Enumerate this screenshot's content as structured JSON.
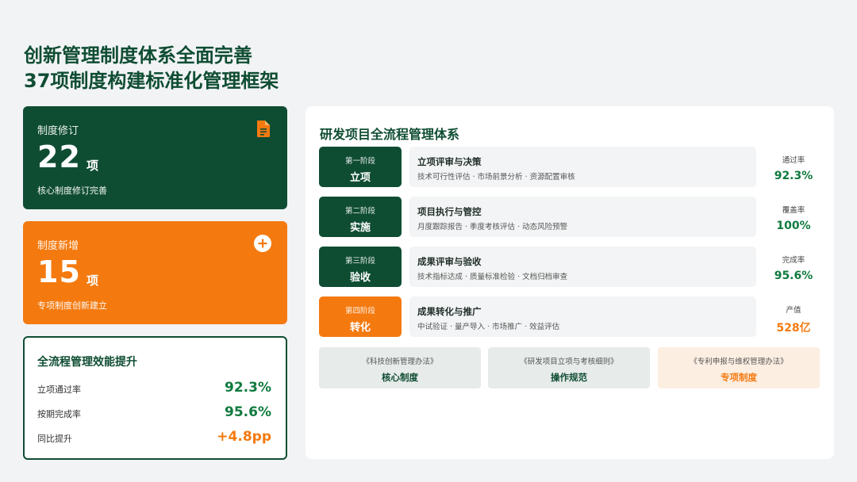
{
  "title": {
    "line1": "创新管理制度体系全面完善",
    "line2": "37项制度构建标准化管理框架"
  },
  "card_revise": {
    "label": "制度修订",
    "number": "22",
    "unit": "项",
    "sub": "核心制度修订完善",
    "icon": "document-icon",
    "color": "#0f4d33"
  },
  "card_new": {
    "label": "制度新增",
    "number": "15",
    "unit": "项",
    "sub": "专项制度创新建立",
    "icon": "plus-circle-icon",
    "color": "#f47a10"
  },
  "efficiency": {
    "title": "全流程管理效能提升",
    "rows": [
      {
        "label": "立项通过率",
        "value": "92.3%"
      },
      {
        "label": "按期完成率",
        "value": "95.6%"
      },
      {
        "label": "同比提升",
        "value": "+4.8pp"
      }
    ]
  },
  "panel": {
    "title": "研发项目全流程管理体系",
    "stages": [
      {
        "phase": "第一阶段",
        "name": "立项",
        "title": "立项评审与决策",
        "desc": "技术可行性评估 · 市场前景分析 · 资源配置审核",
        "metric_label": "通过率",
        "metric_value": "92.3%"
      },
      {
        "phase": "第二阶段",
        "name": "实施",
        "title": "项目执行与管控",
        "desc": "月度跟踪报告 · 季度考核评估 · 动态风险预警",
        "metric_label": "覆盖率",
        "metric_value": "100%"
      },
      {
        "phase": "第三阶段",
        "name": "验收",
        "title": "成果评审与验收",
        "desc": "技术指标达成 · 质量标准检验 · 文档归档审查",
        "metric_label": "完成率",
        "metric_value": "95.6%"
      },
      {
        "phase": "第四阶段",
        "name": "转化",
        "title": "成果转化与推广",
        "desc": "中试验证 · 量产导入 · 市场推广 · 效益评估",
        "metric_label": "产值",
        "metric_value": "528亿"
      }
    ],
    "regulations": [
      {
        "name": "《科技创新管理办法》",
        "type": "核心制度"
      },
      {
        "name": "《研发项目立项与考核细则》",
        "type": "操作规范"
      },
      {
        "name": "《专利申报与维权管理办法》",
        "type": "专项制度"
      }
    ]
  },
  "colors": {
    "primary_green": "#0f4d33",
    "accent_orange": "#f47a10",
    "value_green": "#0f7a3e"
  }
}
